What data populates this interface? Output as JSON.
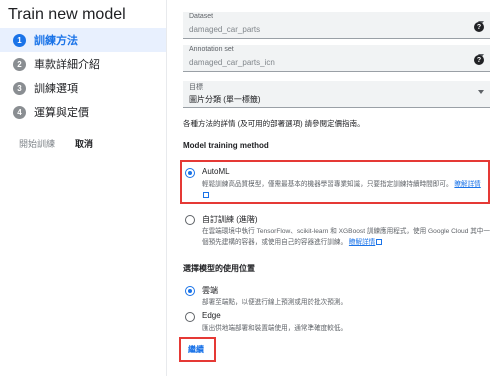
{
  "dialog": {
    "title": "Train new model"
  },
  "sidebar": {
    "steps": [
      {
        "number": "1",
        "label": "訓練方法"
      },
      {
        "number": "2",
        "label": "車款詳細介紹"
      },
      {
        "number": "3",
        "label": "訓練選項"
      },
      {
        "number": "4",
        "label": "運算與定價"
      }
    ],
    "start_training_label": "開始訓練",
    "cancel_label": "取消"
  },
  "form": {
    "dataset": {
      "label": "Dataset",
      "value": "damaged_car_parts"
    },
    "annotation_set": {
      "label": "Annotation set",
      "value": "damaged_car_parts_icn"
    },
    "objective": {
      "label": "目標",
      "value": "圖片分類 (單一標籤)"
    },
    "info_text": "各種方法的詳情 (及可用的部署選項) 請參閱定價指南。",
    "training_method_title": "Model training method",
    "automl": {
      "title": "AutoML",
      "desc": "輕鬆訓練高品質模型，僅需最基本的機器學習專業知識，只要指定訓練持續時間即可。",
      "link": "瞭解詳情"
    },
    "custom": {
      "title": "自訂訓練 (進階)",
      "desc": "在雲端環境中執行 TensorFlow、scikit-learn 和 XGBoost 訓練應用程式，使用 Google Cloud 其中一個預先建構的容器，或使用自己的容器進行訓練。",
      "link": "瞭解詳情"
    },
    "deploy_title": "選擇模型的使用位置",
    "cloud": {
      "title": "雲端",
      "desc": "部署至端點，以便進行線上預測或用於批次預測。"
    },
    "edge": {
      "title": "Edge",
      "desc": "匯出供地端部署和裝置端使用，通常準確度較低。"
    },
    "continue_label": "繼續"
  },
  "colors": {
    "accent": "#1a73e8",
    "highlight": "#e53935",
    "active_step_bg": "#e8f0fe"
  }
}
